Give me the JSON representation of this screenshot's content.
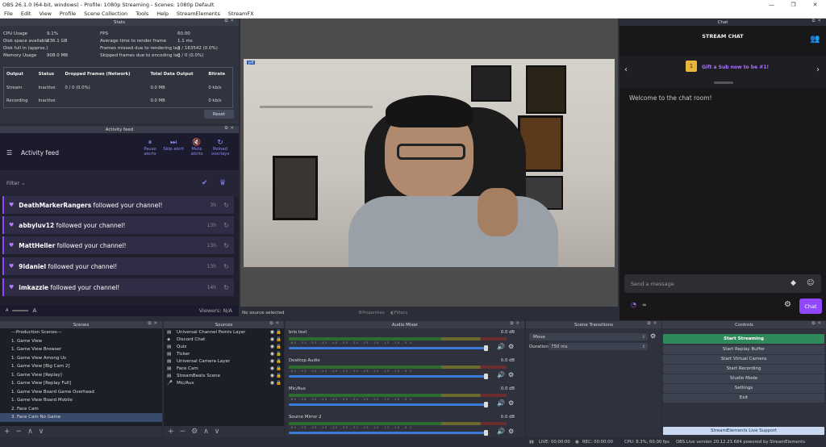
{
  "window": {
    "title": "OBS 26.1.0 (64-bit, windows) - Profile: 1080p Streaming - Scenes: 1080p Default"
  },
  "menu": [
    "File",
    "Edit",
    "View",
    "Profile",
    "Scene Collection",
    "Tools",
    "Help",
    "StreamElements",
    "StreamFX"
  ],
  "stats": {
    "title": "Stats",
    "cpu_label": "CPU Usage",
    "cpu": "9.1%",
    "disk_label": "Disk space available",
    "disk": "236.1 GB",
    "diskfull_label": "Disk full in (approx.)",
    "diskfull": "",
    "mem_label": "Memory Usage",
    "mem": "908.0 MB",
    "fps_label": "FPS",
    "fps": "60.00",
    "render_label": "Average time to render frame",
    "render": "1.1 ms",
    "missed_label": "Frames missed due to rendering lag",
    "missed": "3 / 163542 (0.0%)",
    "skipped_label": "Skipped frames due to encoding lag",
    "skipped": "0 / 0 (0.0%)",
    "headers": [
      "Output",
      "Status",
      "Dropped Frames (Network)",
      "Total Data Output",
      "Bitrate"
    ],
    "rows": [
      [
        "Stream",
        "Inactive",
        "0 / 0 (0.0%)",
        "0.0 MB",
        "0 kb/s"
      ],
      [
        "Recording",
        "Inactive",
        "",
        "0.0 MB",
        "0 kb/s"
      ]
    ],
    "reset": "Reset"
  },
  "activity": {
    "title": "Activity feed",
    "header": "Activity feed",
    "actions": [
      {
        "label": "Pause alerts"
      },
      {
        "label": "Skip alert"
      },
      {
        "label": "Mute alerts"
      },
      {
        "label": "Reload overlays"
      }
    ],
    "filter": "Filter",
    "items": [
      {
        "user": "DeathMarkerRangers",
        "text": " followed your channel!",
        "time": "3h"
      },
      {
        "user": "abbyluv12",
        "text": " followed your channel!",
        "time": "13h"
      },
      {
        "user": "MattHeller",
        "text": " followed your channel!",
        "time": "13h"
      },
      {
        "user": "9ldaniel",
        "text": " followed your channel!",
        "time": "13h"
      },
      {
        "user": "imkazzie",
        "text": " followed your channel!",
        "time": "14h"
      }
    ],
    "viewers": "Viewers: N/A",
    "font_small": "A",
    "font_large": "A"
  },
  "preview": {
    "badge": "Jeff"
  },
  "props_bar": {
    "no_source": "No source selected",
    "properties": "Properties",
    "filters": "Filters"
  },
  "chat": {
    "title": "Chat",
    "header": "STREAM CHAT",
    "promo": "Gift a Sub now to be #1!",
    "promo_count": "1",
    "welcome": "Welcome to the chat room!",
    "placeholder": "Send a message",
    "send": "Chat",
    "points": "∞"
  },
  "scenes": {
    "title": "Scenes",
    "items": [
      "---Production Scenes---",
      "1. Game View",
      "1. Game View Browser",
      "1. Game View Among Us",
      "1. Game View [Big Cam 2]",
      "1. Game View [Replay]",
      "1. Game View [Replay Full]",
      "1. Game View Board Game Overhead",
      "1. Game View Board Mobile",
      "2. Face Cam",
      "3. Face Cam No Game"
    ],
    "selected": 10
  },
  "sources": {
    "title": "Sources",
    "items": [
      "Universal Channel Points Layer",
      "Discord Chat",
      "Quiz",
      "Ticker",
      "Universal Camera Layer",
      "Face Cam",
      "StreamBeats Scene",
      "Mic/Aux"
    ]
  },
  "mixer": {
    "title": "Audio Mixer",
    "scale": "-60 -55 -50 -45 -40 -35 -30 -25 -20 -15 -10 -5 0",
    "channels": [
      {
        "name": "brio text",
        "db": "0.0 dB",
        "level": 0.96
      },
      {
        "name": "Desktop Audio",
        "db": "0.0 dB",
        "level": 0.96
      },
      {
        "name": "Mic/Aux",
        "db": "0.0 dB",
        "level": 0.96
      },
      {
        "name": "Source Mirror 2",
        "db": "0.0 dB",
        "level": 0.96
      }
    ]
  },
  "transitions": {
    "title": "Scene Transitions",
    "value": "Move",
    "duration_label": "Duration",
    "duration": "750 ms"
  },
  "controls": {
    "title": "Controls",
    "buttons": [
      "Start Streaming",
      "Start Replay Buffer",
      "Start Virtual Camera",
      "Start Recording",
      "Studio Mode",
      "Settings",
      "Exit"
    ],
    "support": "StreamElements Live Support"
  },
  "status": {
    "live": "LIVE: 00:00:00",
    "rec": "REC: 00:00:00",
    "cpu": "CPU: 8.3%, 60.00 fps",
    "version": "OBS.Live version 20.12.23.684 powered by StreamElements"
  }
}
